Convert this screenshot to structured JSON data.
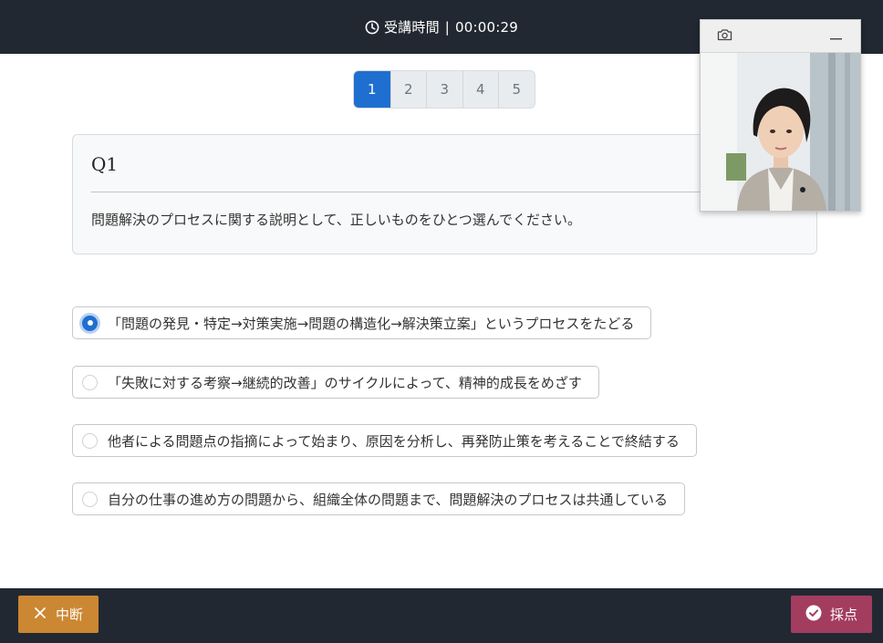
{
  "header": {
    "timer_label": "受講時間",
    "separator": "|",
    "timer_value": "00:00:29",
    "clock_icon": "clock-icon"
  },
  "pagination": {
    "pages": [
      "1",
      "2",
      "3",
      "4",
      "5"
    ],
    "active_page": "1"
  },
  "question": {
    "number": "Q1",
    "text": "問題解決のプロセスに関する説明として、正しいものをひとつ選んでください。"
  },
  "options": [
    {
      "label": "「問題の発見・特定→対策実施→問題の構造化→解決策立案」というプロセスをたどる",
      "selected": true
    },
    {
      "label": "「失敗に対する考察→継続的改善」のサイクルによって、精神的成長をめざす",
      "selected": false
    },
    {
      "label": "他者による問題点の指摘によって始まり、原因を分析し、再発防止策を考えることで終結する",
      "selected": false
    },
    {
      "label": "自分の仕事の進め方の問題から、組織全体の問題まで、問題解決のプロセスは共通している",
      "selected": false
    }
  ],
  "video_panel": {
    "camera_icon": "camera-icon",
    "minimize_icon": "minimize-icon"
  },
  "footer": {
    "stop_label": "中断",
    "stop_icon": "close-icon",
    "grade_label": "採点",
    "grade_icon": "check-circle-icon"
  },
  "colors": {
    "bar_bg": "#222831",
    "accent_blue": "#1f6fd0",
    "stop_button": "#cc8732",
    "grade_button": "#a33d5f"
  }
}
